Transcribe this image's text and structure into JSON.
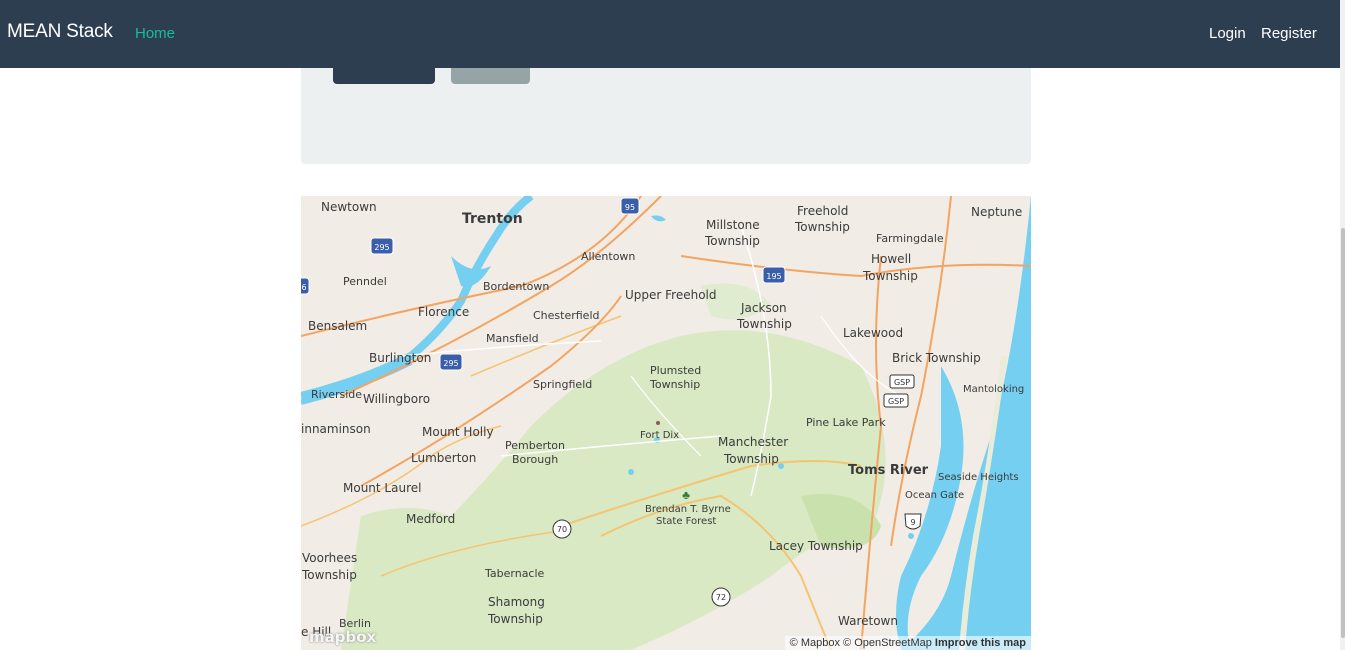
{
  "navbar": {
    "brand": "MEAN Stack",
    "home": "Home",
    "login": "Login",
    "register": "Register"
  },
  "map": {
    "labels": {
      "newtown": "Newtown",
      "trenton": "Trenton",
      "millstone": "Millstone",
      "millstone2": "Township",
      "freehold": "Freehold",
      "freehold2": "Township",
      "neptune": "Neptune",
      "farmingdale": "Farmingdale",
      "allentown": "Allentown",
      "howell": "Howell",
      "howell2": "Township",
      "penndel": "Penndel",
      "bordentown": "Bordentown",
      "upperfreehold": "Upper Freehold",
      "jackson": "Jackson",
      "jackson2": "Township",
      "bensalem": "Bensalem",
      "florence": "Florence",
      "chesterfield": "Chesterfield",
      "lakewood": "Lakewood",
      "mansfield": "Mansfield",
      "burlington": "Burlington",
      "brick": "Brick Township",
      "plumsted": "Plumsted",
      "plumsted2": "Township",
      "springfield": "Springfield",
      "mantoloking": "Mantoloking",
      "riverside": "Riverside",
      "willingboro": "Willingboro",
      "pinelake": "Pine Lake Park",
      "fortdix": "Fort Dix",
      "cinnaminson": "innaminson",
      "mountholly": "Mount Holly",
      "pemberton": "Pemberton",
      "pemberton2": "Borough",
      "manchester": "Manchester",
      "manchester2": "Township",
      "lumberton": "Lumberton",
      "tomsriver": "Toms River",
      "seaside": "Seaside Heights",
      "mountlaurel": "Mount Laurel",
      "oceangate": "Ocean Gate",
      "brendan": "Brendan T. Byrne",
      "brendan2": "State Forest",
      "medford": "Medford",
      "lacey": "Lacey Township",
      "voorhees": "Voorhees",
      "voorhees2": "Township",
      "tabernacle": "Tabernacle",
      "shamong": "Shamong",
      "shamong2": "Township",
      "berlin": "Berlin",
      "waretown": "Waretown",
      "cherryhill": "e Hill"
    },
    "shields": {
      "i95": "95",
      "i295a": "295",
      "i295b": "295",
      "i195": "195",
      "i6": "6",
      "gsp1": "GSP",
      "gsp2": "GSP",
      "r70": "70",
      "r72": "72",
      "r9": "9"
    },
    "logo": "mapbox",
    "attribution": {
      "mapbox": "© Mapbox",
      "osm": "© OpenStreetMap",
      "improve": "Improve this map"
    }
  }
}
